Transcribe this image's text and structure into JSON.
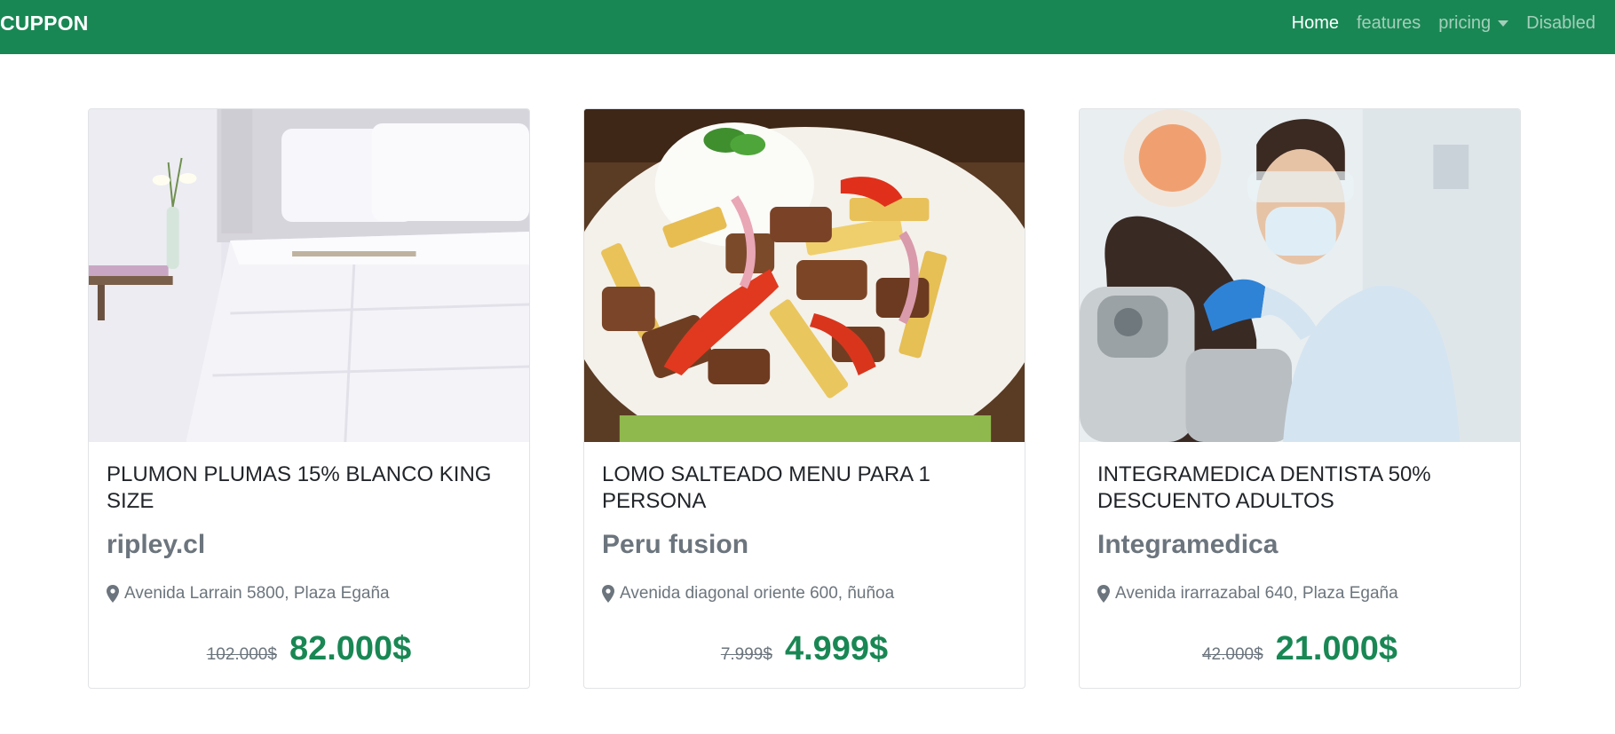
{
  "navbar": {
    "brand": "CUPPON",
    "links": [
      {
        "label": "Home",
        "active": true
      },
      {
        "label": "features",
        "active": false
      },
      {
        "label": "pricing",
        "active": false,
        "dropdown": true
      },
      {
        "label": "Disabled",
        "active": false
      }
    ]
  },
  "colors": {
    "brand": "#198754",
    "muted": "#6c757d"
  },
  "cards": [
    {
      "image": "bed-with-white-duvet",
      "title": "PLUMON PLUMAS 15% BLANCO KING SIZE",
      "store": "ripley.cl",
      "address": "Avenida Larrain 5800, Plaza Egaña",
      "old_price": "102.000$",
      "new_price": "82.000$"
    },
    {
      "image": "lomo-saltado-plate",
      "title": "LOMO SALTEADO MENU PARA 1 PERSONA",
      "store": "Peru fusion",
      "address": "Avenida diagonal oriente 600, ñuñoa",
      "old_price": "7.999$",
      "new_price": "4.999$"
    },
    {
      "image": "dentist-treating-patient",
      "title": "INTEGRAMEDICA DENTISTA 50% DESCUENTO ADULTOS",
      "store": "Integramedica",
      "address": "Avenida irarrazabal 640, Plaza Egaña",
      "old_price": "42.000$",
      "new_price": "21.000$"
    }
  ]
}
